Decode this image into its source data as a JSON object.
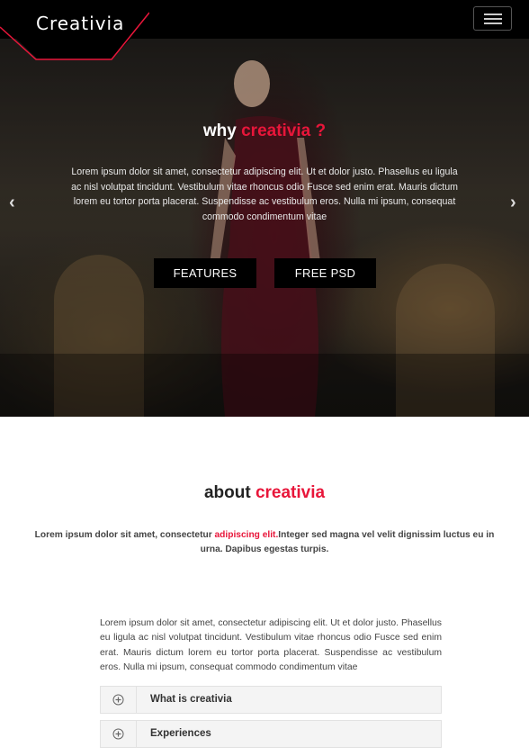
{
  "brand": {
    "logo_text": "Creativia",
    "accent_color": "#e8163a"
  },
  "nav": {
    "menu_icon": "hamburger-icon"
  },
  "hero": {
    "title_plain": "why ",
    "title_accent": "creativia ?",
    "text": "Lorem ipsum dolor sit amet, consectetur adipiscing elit. Ut et dolor justo. Phasellus eu ligula ac nisl volutpat tincidunt. Vestibulum vitae rhoncus odio Fusce sed enim erat. Mauris dictum lorem eu tortor porta placerat. Suspendisse ac vestibulum eros. Nulla mi ipsum, consequat commodo condimentum vitae",
    "prev_arrow": "‹",
    "next_arrow": "›",
    "buttons": [
      {
        "label": "FEATURES"
      },
      {
        "label": "FREE PSD"
      }
    ]
  },
  "about": {
    "title_plain": "about ",
    "title_accent": "creativia",
    "sub_before": "Lorem ipsum dolor sit amet, consectetur ",
    "sub_accent": "adipiscing elit.",
    "sub_after": "Integer sed magna vel velit dignissim luctus eu in urna. Dapibus egestas turpis.",
    "body": "Lorem ipsum dolor sit amet, consectetur adipiscing elit. Ut et dolor justo. Phasellus eu ligula ac nisl volutpat tincidunt. Vestibulum vitae rhoncus odio Fusce sed enim erat. Mauris dictum lorem eu tortor porta placerat. Suspendisse ac vestibulum eros. Nulla mi ipsum, consequat commodo condimentum vitae",
    "accordion": [
      {
        "label": "What is creativia",
        "icon": "plus-circle-icon"
      },
      {
        "label": "Experiences",
        "icon": "plus-circle-icon"
      }
    ]
  }
}
